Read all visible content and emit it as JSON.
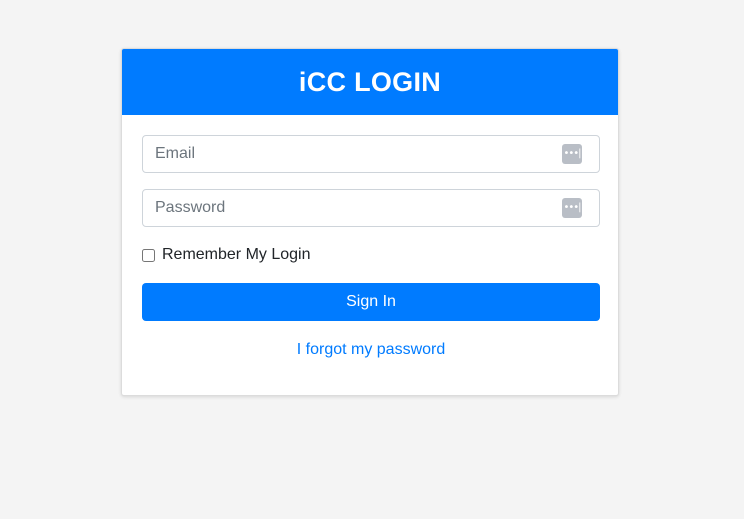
{
  "header": {
    "title": "iCC LOGIN"
  },
  "form": {
    "email": {
      "placeholder": "Email",
      "value": "",
      "icon": "password-manager-icon"
    },
    "password": {
      "placeholder": "Password",
      "value": "",
      "icon": "password-manager-icon"
    },
    "remember": {
      "label": "Remember My Login",
      "checked": false
    },
    "signin_label": "Sign In",
    "forgot_label": "I forgot my password"
  },
  "icons": {
    "password_manager_glyph": "•••|"
  },
  "colors": {
    "accent": "#007bff",
    "background": "#f4f4f4",
    "card": "#ffffff"
  }
}
